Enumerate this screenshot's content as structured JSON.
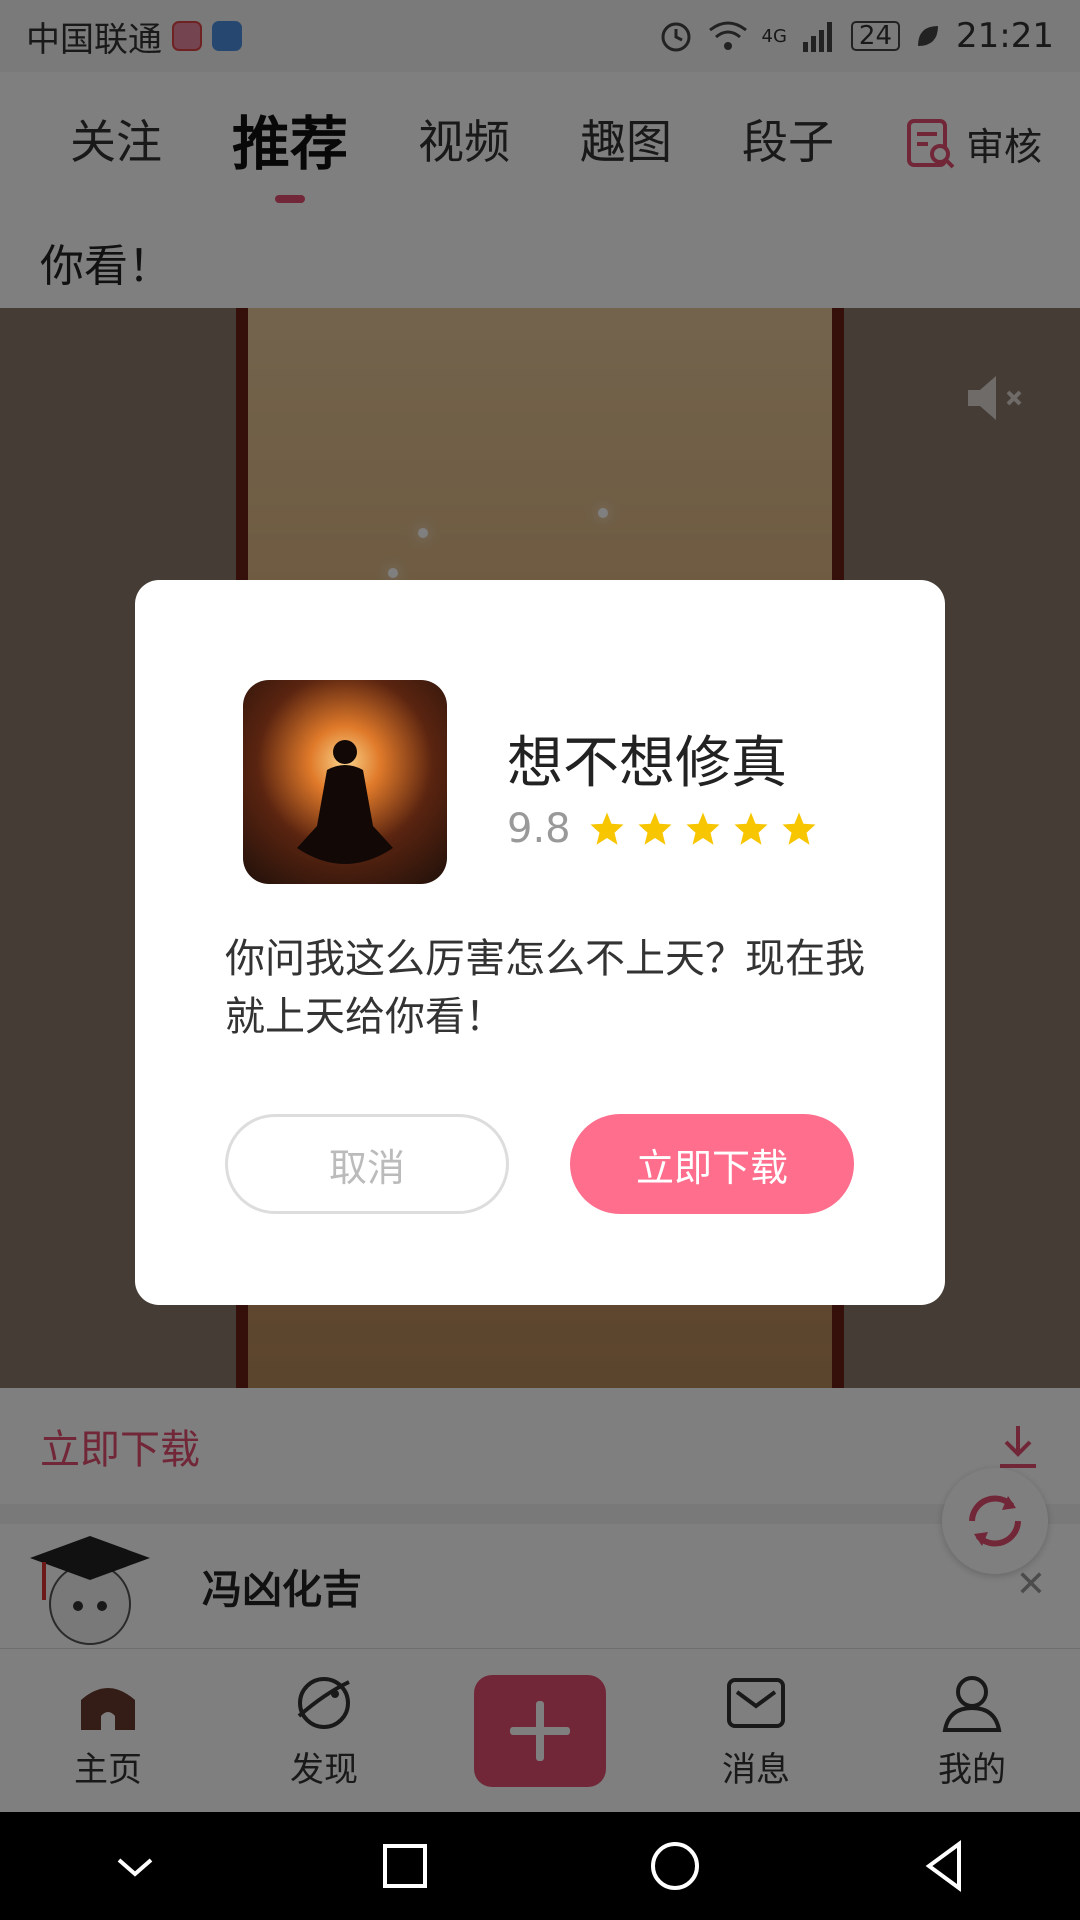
{
  "status_bar": {
    "carrier": "中国联通",
    "network": "4G",
    "battery": "24",
    "time": "21:21"
  },
  "top_tabs": [
    {
      "label": "关注"
    },
    {
      "label": "推荐",
      "active": true
    },
    {
      "label": "视频"
    },
    {
      "label": "趣图"
    },
    {
      "label": "段子"
    }
  ],
  "review": {
    "label": "审核"
  },
  "post": {
    "title": "你看！"
  },
  "download_strip": {
    "label": "立即下载"
  },
  "author": {
    "name": "冯凶化吉"
  },
  "bottom_nav": [
    {
      "label": "主页",
      "icon": "home-icon",
      "active": true
    },
    {
      "label": "发现",
      "icon": "planet-icon"
    },
    {
      "label": "",
      "icon": "add-icon"
    },
    {
      "label": "消息",
      "icon": "mail-icon"
    },
    {
      "label": "我的",
      "icon": "person-icon"
    }
  ],
  "dialog": {
    "app_name": "想不想修真",
    "rating": "9.8",
    "stars": 5,
    "description": "你问我这么厉害怎么不上天？现在我就上天给你看！",
    "cancel_label": "取消",
    "download_label": "立即下载"
  },
  "colors": {
    "accent": "#e34f6f",
    "download_button": "#ff6e8c",
    "star": "#f7c600"
  }
}
